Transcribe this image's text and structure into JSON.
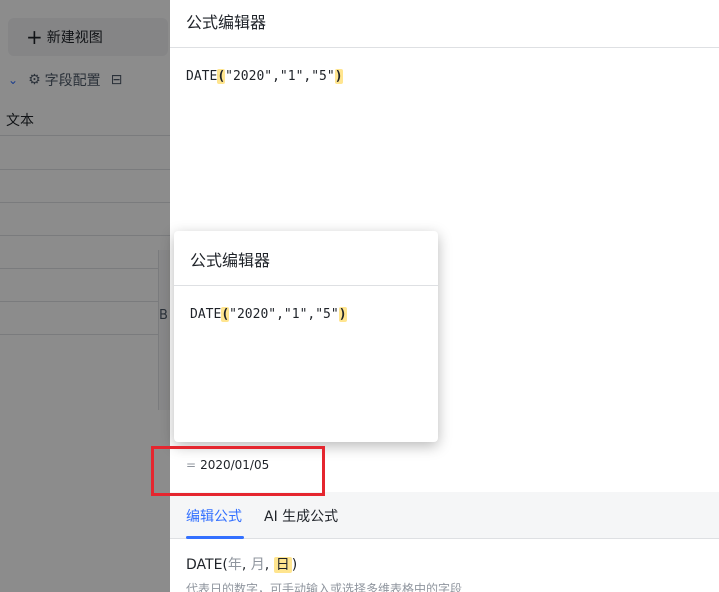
{
  "background": {
    "new_view_label": "新建视图",
    "field_config_label": "字段配置",
    "column_header": "文本",
    "cut_glyph": "B"
  },
  "editor": {
    "title": "公式编辑器",
    "formula_prefix": "DATE",
    "formula_open": "(",
    "formula_args": "\"2020\",\"1\",\"5\"",
    "formula_close": ")"
  },
  "popup": {
    "title": "公式编辑器",
    "formula_prefix": "DATE",
    "formula_open": "(",
    "formula_args": "\"2020\",\"1\",\"5\"",
    "formula_close": ")"
  },
  "result": {
    "eq": "=",
    "value": "2020/01/05"
  },
  "tabs": {
    "edit_label": "编辑公式",
    "ai_label": "AI 生成公式"
  },
  "function_help": {
    "name": "DATE",
    "open": "(",
    "arg_year": "年",
    "comma1": ", ",
    "arg_month": "月",
    "comma2": ", ",
    "arg_day": "日",
    "close": ")",
    "description": "代表日的数字，可手动输入或选择多维表格中的字段"
  },
  "colors": {
    "accent": "#3370ff",
    "highlight": "#ffe58f",
    "annotation_red": "#e5262f"
  }
}
